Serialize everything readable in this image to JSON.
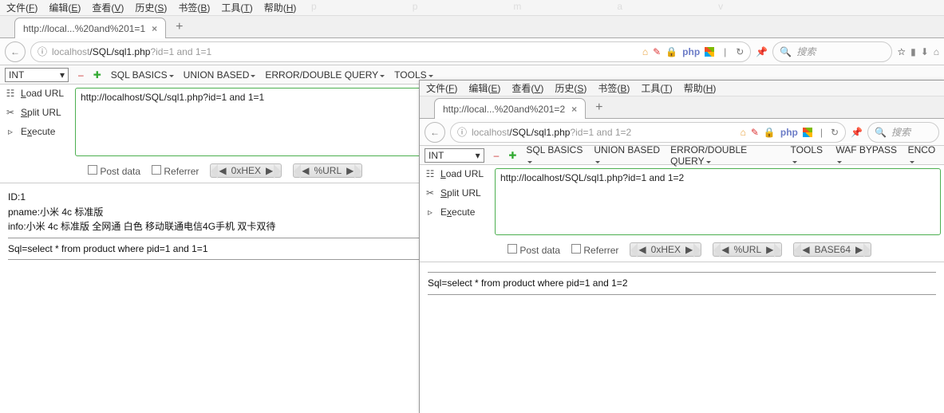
{
  "menu": {
    "file": "文件(",
    "file_u": "F",
    "file2": ")",
    "edit": "编辑(",
    "edit_u": "E",
    "view": "查看(",
    "view_u": "V",
    "hist": "历史(",
    "hist_u": "S",
    "book": "书签(",
    "book_u": "B",
    "tool": "工具(",
    "tool_u": "T",
    "help": "帮助(",
    "help_u": "H",
    "close": ")"
  },
  "w1": {
    "tab": "http://local...%20and%201=1",
    "url_host": "localhost",
    "url_path": "/SQL/sql1.php",
    "url_q": "?id=1 and 1=1",
    "search_ph": "搜索",
    "int": "INT",
    "sqlmenu": [
      "SQL BASICS",
      "UNION BASED",
      "ERROR/DOUBLE QUERY",
      "TOOLS"
    ],
    "tools": {
      "load": "Load URL",
      "split": "Split URL",
      "exec": "Execute"
    },
    "urlbox": "http://localhost/SQL/sql1.php?id=1 and 1=1",
    "opt": {
      "post": "Post data",
      "ref": "Referrer",
      "hex": "0xHEX",
      "url": "%URL"
    },
    "result": {
      "l1": "ID:1",
      "l2": "pname:小米 4c 标准版",
      "l3": "info:小米 4c 标准版 全网通 白色 移动联通电信4G手机 双卡双待",
      "sql": "Sql=select * from product where pid=1 and 1=1"
    }
  },
  "w2": {
    "tab": "http://local...%20and%201=2",
    "url_host": "localhost",
    "url_path": "/SQL/sql1.php",
    "url_q": "?id=1 and 1=2",
    "search_ph": "搜索",
    "int": "INT",
    "sqlmenu": [
      "SQL BASICS",
      "UNION BASED",
      "ERROR/DOUBLE QUERY",
      "TOOLS",
      "WAF BYPASS",
      "ENCO"
    ],
    "tools": {
      "load": "Load URL",
      "split": "Split URL",
      "exec": "Execute"
    },
    "urlbox": "http://localhost/SQL/sql1.php?id=1 and 1=2",
    "opt": {
      "post": "Post data",
      "ref": "Referrer",
      "hex": "0xHEX",
      "url": "%URL",
      "b64": "BASE64"
    },
    "result": {
      "sql": "Sql=select * from product where pid=1 and 1=2"
    }
  },
  "ghost": [
    "p",
    "p",
    "m",
    "a",
    "v"
  ]
}
